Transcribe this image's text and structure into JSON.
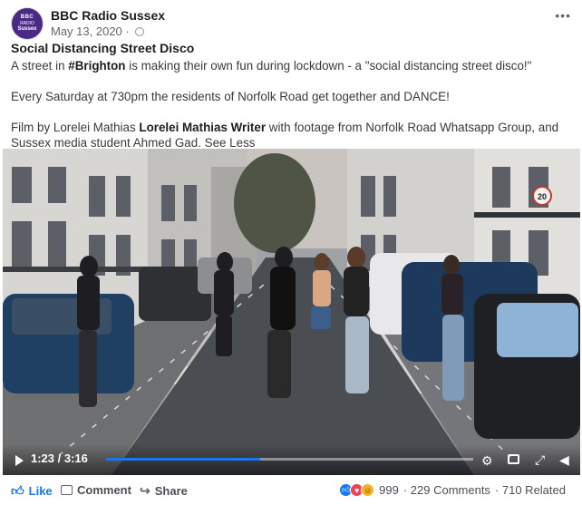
{
  "post": {
    "avatar": {
      "line1": "BBC",
      "line2": "RADIO",
      "line3": "Sussex"
    },
    "page_name": "BBC Radio Sussex",
    "date": "May 13, 2020 ·",
    "more": "•••",
    "title": "Social Distancing Street Disco",
    "text": {
      "line1_before": "A street in ",
      "hashtag": "#Brighton",
      "line1_after": " is making their own fun during lockdown - a \"social distancing street disco!\"",
      "line2": "Every Saturday at 730pm the residents of Norfolk Road get together and DANCE!",
      "line3_before": "Film by Lorelei Mathias ",
      "credit": "Lorelei Mathias Writer",
      "line3_after": " with footage from Norfolk Road Whatsapp Group, and Sussex media student Ahmed Gad. ",
      "see_less": "See Less"
    }
  },
  "video": {
    "time": "1:23 / 3:16",
    "progress": 0.42,
    "road_sign": "20"
  },
  "actions": {
    "like": "Like",
    "comment": "Comment",
    "share": "Share"
  },
  "stats": {
    "reactions_count": "999",
    "comments": "· 229 Comments",
    "related": "· 710 Related"
  },
  "colors": {
    "accent": "#1877f2",
    "avatar_bg": "#4b2a85"
  }
}
